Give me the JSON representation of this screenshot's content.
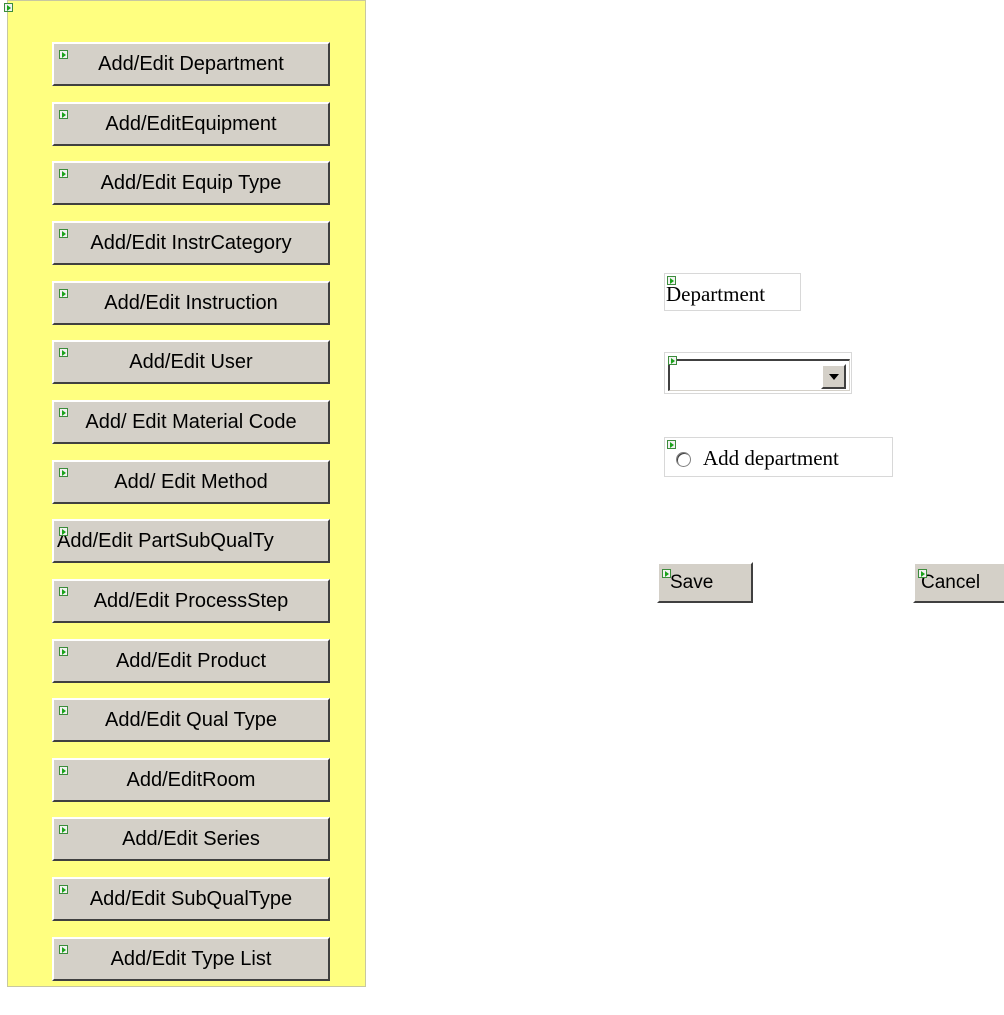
{
  "sidebar": {
    "buttons": [
      {
        "label": "Add/Edit Department"
      },
      {
        "label": "Add/EditEquipment"
      },
      {
        "label": "Add/Edit Equip Type"
      },
      {
        "label": "Add/Edit InstrCategory"
      },
      {
        "label": "Add/Edit Instruction"
      },
      {
        "label": "Add/Edit User"
      },
      {
        "label": "Add/ Edit Material Code"
      },
      {
        "label": "Add/ Edit Method"
      },
      {
        "label": "Add/Edit PartSubQualTy"
      },
      {
        "label": "Add/Edit ProcessStep"
      },
      {
        "label": "Add/Edit Product"
      },
      {
        "label": "Add/Edit Qual Type"
      },
      {
        "label": "Add/EditRoom"
      },
      {
        "label": "Add/Edit Series"
      },
      {
        "label": "Add/Edit SubQualType"
      },
      {
        "label": "Add/Edit Type List"
      }
    ]
  },
  "form": {
    "field_label": "Department",
    "select": {
      "selected_value": ""
    },
    "radio": {
      "label": "Add department",
      "checked": false
    }
  },
  "actions": {
    "save_label": "Save",
    "cancel_label": "Cancel"
  },
  "colors": {
    "sidebar_bg": "#ffff80",
    "button_face": "#d4d0c8",
    "marker_icon": "#1aa31a"
  },
  "icons": {
    "marker": "green-arrow-marker-icon",
    "dropdown": "chevron-down-icon"
  }
}
